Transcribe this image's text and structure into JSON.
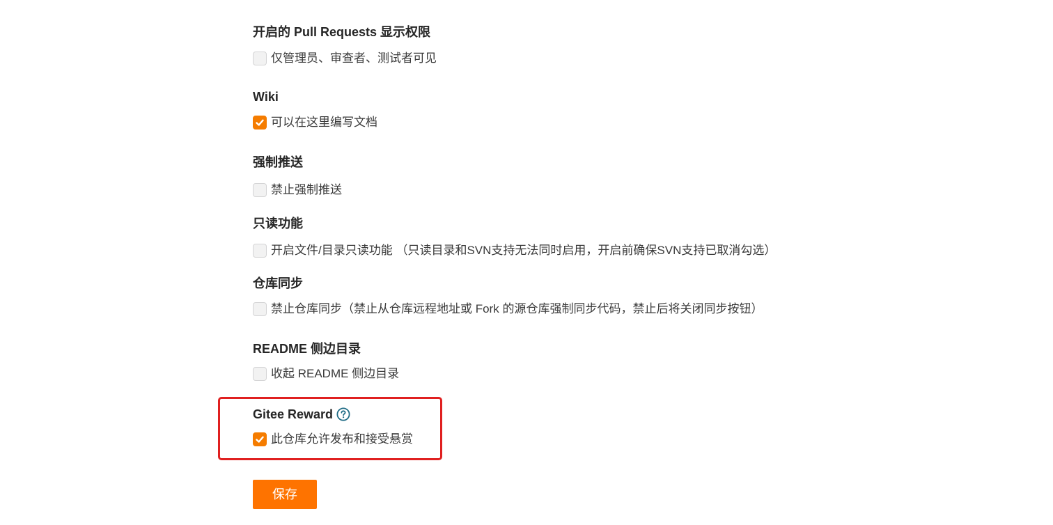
{
  "sections": [
    {
      "title": "开启的 Pull Requests 显示权限",
      "option_label": "仅管理员、审查者、测试者可见",
      "checked": false
    },
    {
      "title": "Wiki",
      "option_label": "可以在这里编写文档",
      "checked": true
    },
    {
      "title": "强制推送",
      "option_label": "禁止强制推送",
      "checked": false
    },
    {
      "title": "只读功能",
      "option_label": "开启文件/目录只读功能 （只读目录和SVN支持无法同时启用，开启前确保SVN支持已取消勾选）",
      "checked": false
    },
    {
      "title": "仓库同步",
      "option_label": "禁止仓库同步（禁止从仓库远程地址或 Fork 的源仓库强制同步代码，禁止后将关闭同步按钮）",
      "checked": false
    },
    {
      "title": "README 侧边目录",
      "option_label": "收起 README 侧边目录",
      "checked": false
    },
    {
      "title": "Gitee Reward",
      "option_label": "此仓库允许发布和接受悬赏",
      "checked": true,
      "icon": "help-circle-icon"
    }
  ],
  "save_button": {
    "label": "保存"
  },
  "colors": {
    "accent": "#fe7300",
    "checkbox_checked": "#f57c00",
    "highlight_border": "#e02020",
    "help_icon": "#1e6b85"
  }
}
